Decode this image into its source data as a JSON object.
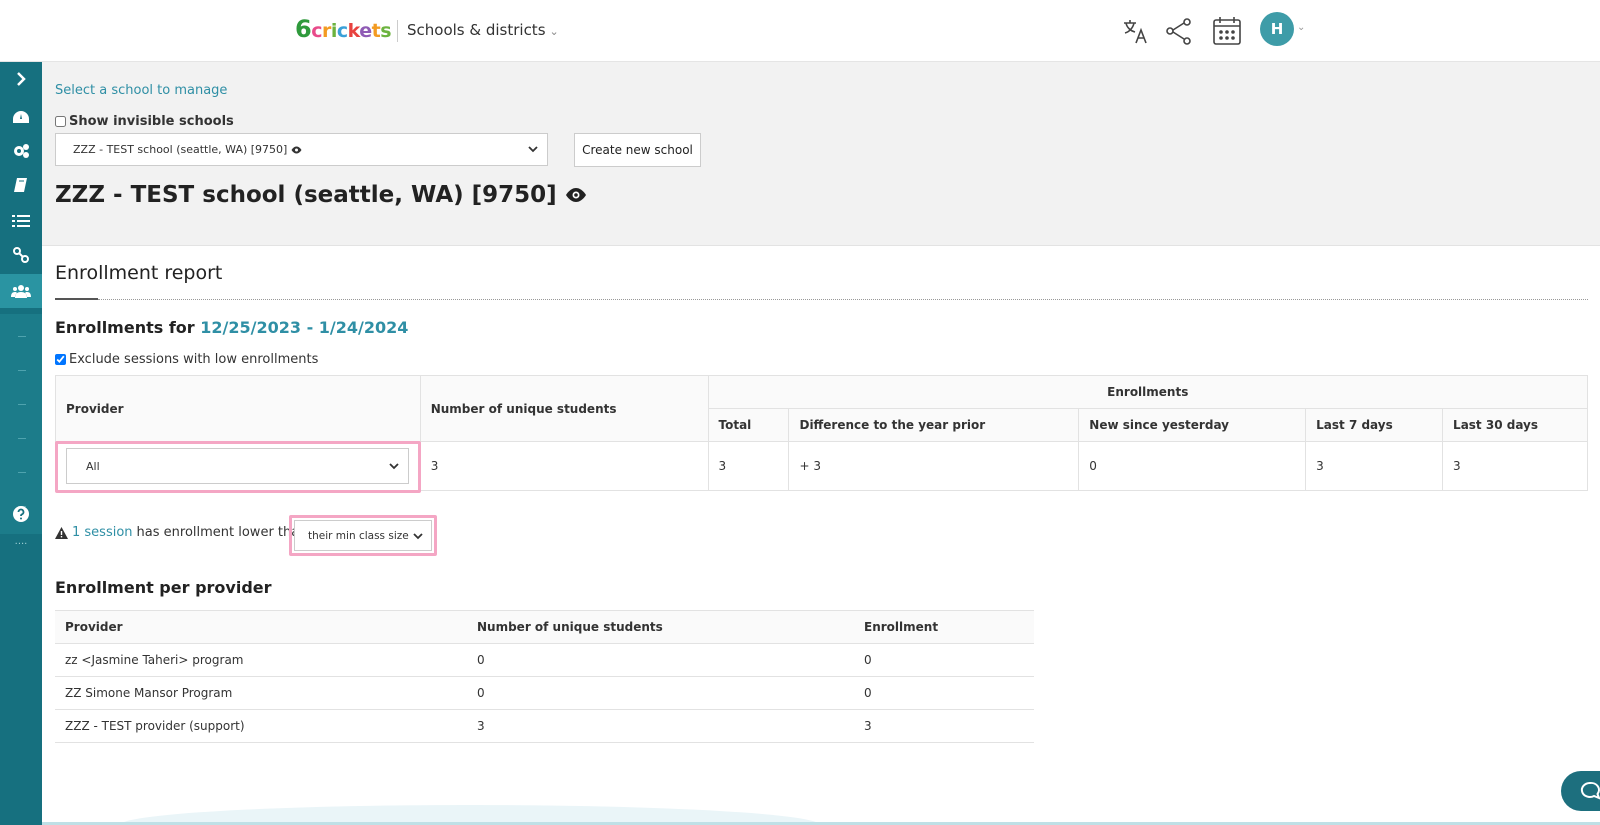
{
  "header": {
    "logo": {
      "d6": "6",
      "c1": "c",
      "c2": "r",
      "c3": "i",
      "c4": "c",
      "c5": "k",
      "c6": "e",
      "c7": "t",
      "c8": "s"
    },
    "section_title": "Schools & districts",
    "avatar_initial": "H",
    "icons": [
      "translate-icon",
      "share-icon",
      "calendar-icon",
      "chevron-down-icon"
    ]
  },
  "sidebar": {
    "items": [
      "expand-icon",
      "dashboard-icon",
      "settings-icon",
      "book-icon",
      "list-icon",
      "link-icon",
      "users-icon",
      "help-icon"
    ],
    "dots": "....",
    "active_color": "#2a94a2",
    "background_color": "#16707f"
  },
  "school": {
    "select_link": "Select a school to manage",
    "show_invisible_label": "Show invisible schools",
    "selected_school": "ZZZ - TEST school (seattle, WA) [9750]",
    "create_button": "Create new school",
    "title": "ZZZ - TEST school (seattle, WA) [9750]"
  },
  "report": {
    "title": "Enrollment report",
    "enrollments_for_label": "Enrollments for",
    "date_range": "12/25/2023 - 1/24/2024",
    "exclude_label": "Exclude sessions with low enrollments",
    "table": {
      "headers": {
        "provider": "Provider",
        "unique_students": "Number of unique students",
        "enrollments": "Enrollments",
        "total": "Total",
        "difference": "Difference to the year prior",
        "new_since_yesterday": "New since yesterday",
        "last_7": "Last 7 days",
        "last_30": "Last 30 days"
      },
      "row": {
        "provider_select": "All",
        "unique_students": "3",
        "total": "3",
        "difference": "+ 3",
        "new_since_yesterday": "0",
        "last_7": "3",
        "last_30": "3"
      }
    },
    "warning": {
      "link": "1 session",
      "text": "has enrollment lower than",
      "select": "their min class size"
    }
  },
  "per_provider": {
    "title": "Enrollment per provider",
    "headers": [
      "Provider",
      "Number of unique students",
      "Enrollment"
    ],
    "rows": [
      [
        "zz <Jasmine Taheri> program",
        "0",
        "0"
      ],
      [
        "ZZ Simone Mansor Program",
        "0",
        "0"
      ],
      [
        "ZZZ - TEST provider (support)",
        "3",
        "3"
      ]
    ]
  },
  "colors": {
    "link": "#2f8fa5",
    "highlight": "#f4a6c4",
    "avatar": "#3e9ca8"
  }
}
